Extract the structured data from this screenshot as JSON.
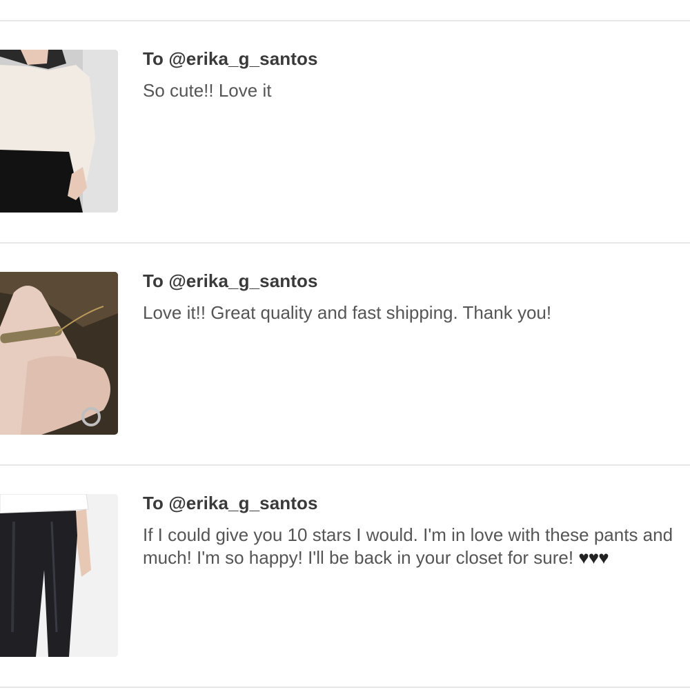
{
  "comments": [
    {
      "recipient": "To @erika_g_santos",
      "message": "So cute!! Love it",
      "image_icon": "white-off-shoulder-sweater-photo"
    },
    {
      "recipient": "To @erika_g_santos",
      "message": "Love it!! Great quality and fast shipping. Thank you!",
      "image_icon": "bar-necklace-photo"
    },
    {
      "recipient": "To @erika_g_santos",
      "message": "If I could give you 10 stars I would. I'm in love with these pants and much! I'm so happy! I'll be back in your closet for sure!",
      "hearts": "♥♥♥",
      "image_icon": "leather-pants-photo"
    }
  ]
}
